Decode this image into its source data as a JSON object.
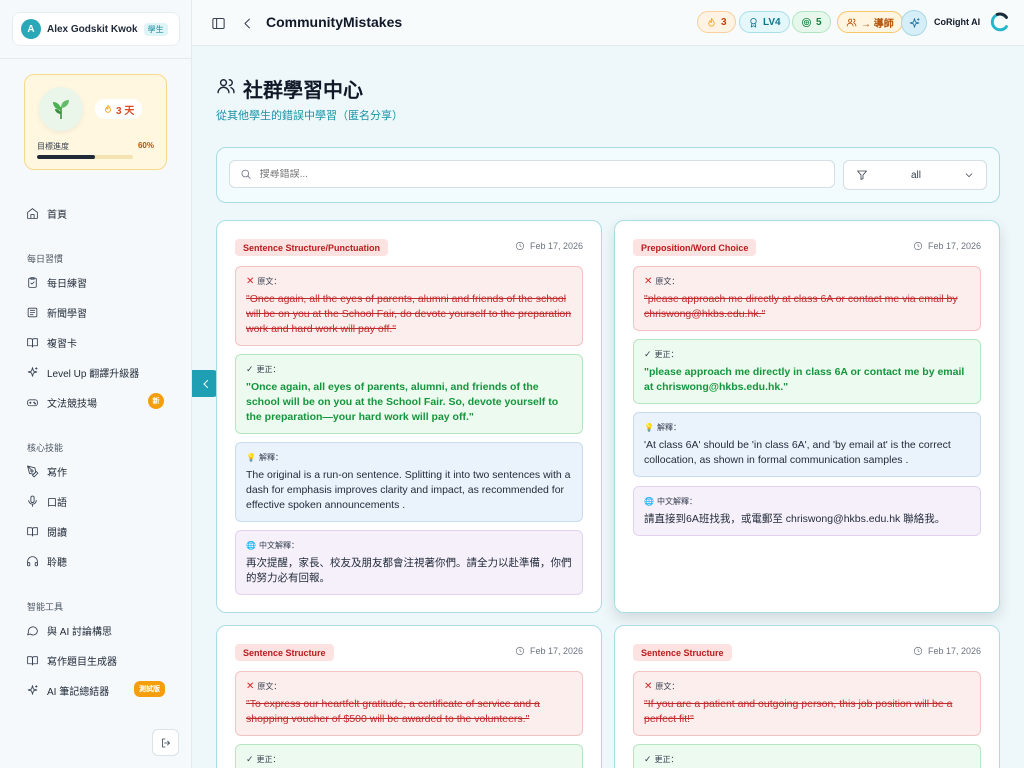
{
  "user": {
    "initial": "A",
    "name": "Alex Godskit Kwok",
    "role": "學生"
  },
  "streak": {
    "days": "3 天",
    "goal_label": "目標進度",
    "goal_pct": "60%",
    "goal_fraction": 0.6
  },
  "nav": {
    "home": "首頁",
    "section_daily": "每日習慣",
    "daily_practice": "每日練習",
    "news_learning": "新聞學習",
    "review_cards": "複習卡",
    "level_up": "Level Up 翻譯升級器",
    "grammar_arena": "文法競技場",
    "new_badge": "新",
    "section_core": "核心技能",
    "writing": "寫作",
    "speaking": "口語",
    "reading": "閱讀",
    "listening": "聆聽",
    "section_ai": "智能工具",
    "ai_discuss": "與 AI 討論構思",
    "prompt_gen": "寫作題目生成器",
    "ai_notes": "AI 筆記總結器",
    "beta_badge": "測試版"
  },
  "header": {
    "crumb": "CommunityMistakes",
    "streak_count": "3",
    "level": "LV4",
    "coins": "5",
    "mentor": "→ 導師",
    "ai_name": "CoRight AI"
  },
  "page": {
    "title": "社群學習中心",
    "subtitle": "從其他學生的錯誤中學習（匿名分享）"
  },
  "filters": {
    "search_placeholder": "搜尋錯誤...",
    "category_value": "all"
  },
  "labels": {
    "original": "原文：",
    "corrected": "更正：",
    "explanation": "解釋：",
    "zh_explanation": "中文解釋："
  },
  "cards": [
    {
      "tag": "Sentence Structure/Punctuation",
      "date": "Feb 17, 2026",
      "original": "\"Once again, all the eyes of parents, alumni and friends of the school will be on you at the School Fair, do devote yourself to the preparation work and hard work will pay off.\"",
      "corrected": "\"Once again, all eyes of parents, alumni, and friends of the school will be on you at the School Fair. So, devote yourself to the preparation—your hard work will pay off.\"",
      "explanation": "The original is a run-on sentence. Splitting it into two sentences with a dash for emphasis improves clarity and impact, as recommended for effective spoken announcements .",
      "zh": "再次提醒，家長、校友及朋友都會注視著你們。請全力以赴準備，你們的努力必有回報。"
    },
    {
      "tag": "Preposition/Word Choice",
      "date": "Feb 17, 2026",
      "original": "\"please approach me directly at class 6A or contact me via email by chriswong@hkbs.edu.hk.\"",
      "corrected": "\"please approach me directly in class 6A or contact me by email at chriswong@hkbs.edu.hk.\"",
      "explanation": "'At class 6A' should be 'in class 6A', and 'by email at' is the correct collocation, as shown in formal communication samples .",
      "zh": "請直接到6A班找我，或電郵至 chriswong@hkbs.edu.hk 聯絡我。"
    },
    {
      "tag": "Sentence Structure",
      "date": "Feb 17, 2026",
      "original": "\"To express our heartfelt gratitude, a certificate of service and a shopping voucher of $500 will be awarded to the volunteers.\""
    },
    {
      "tag": "Sentence Structure",
      "date": "Feb 17, 2026",
      "original": "\"If you are a patient and outgoing person, this job position will be a perfect fit!\""
    }
  ]
}
